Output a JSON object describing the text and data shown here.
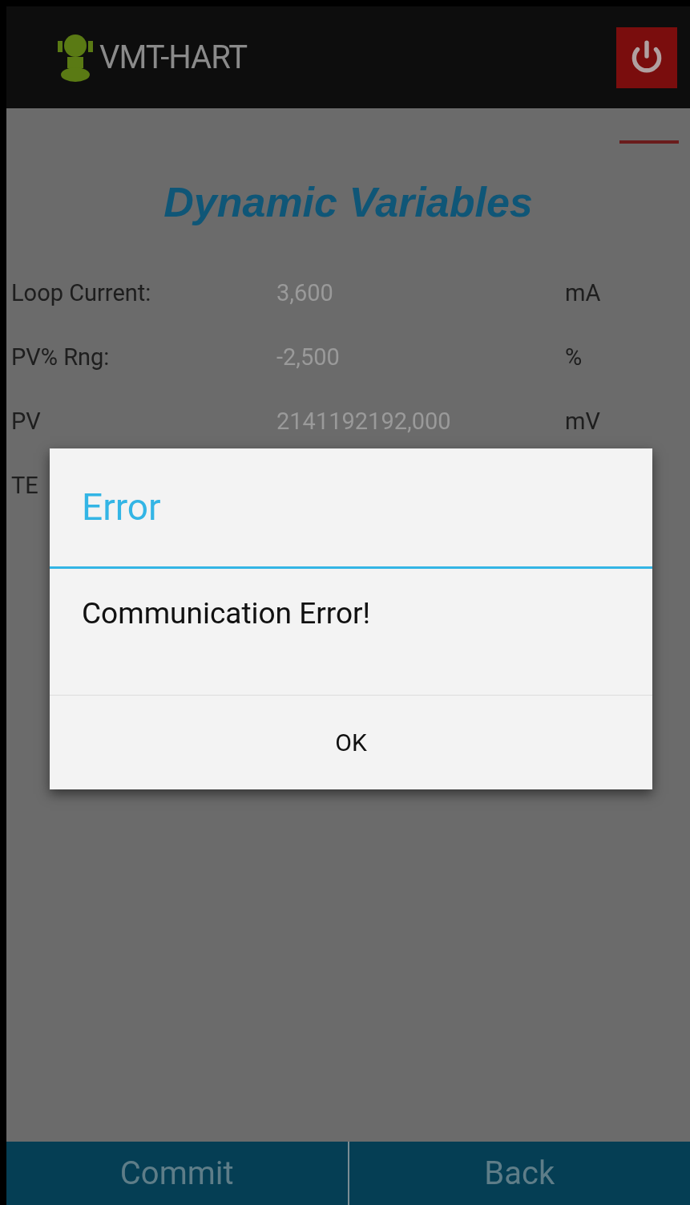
{
  "app_bar": {
    "title": "VMT-HART"
  },
  "page_title": "Dynamic Variables",
  "variables": [
    {
      "label": "Loop Current:",
      "value": "3,600",
      "unit": "mA"
    },
    {
      "label": "PV% Rng:",
      "value": "-2,500",
      "unit": "%"
    },
    {
      "label": "PV",
      "value": "2141192192,000",
      "unit": "mV"
    },
    {
      "label": "TE"
    }
  ],
  "dialog": {
    "title": "Error",
    "message": "Communication Error!",
    "button": "OK"
  },
  "bottom_bar": [
    "Commit",
    "Back"
  ]
}
